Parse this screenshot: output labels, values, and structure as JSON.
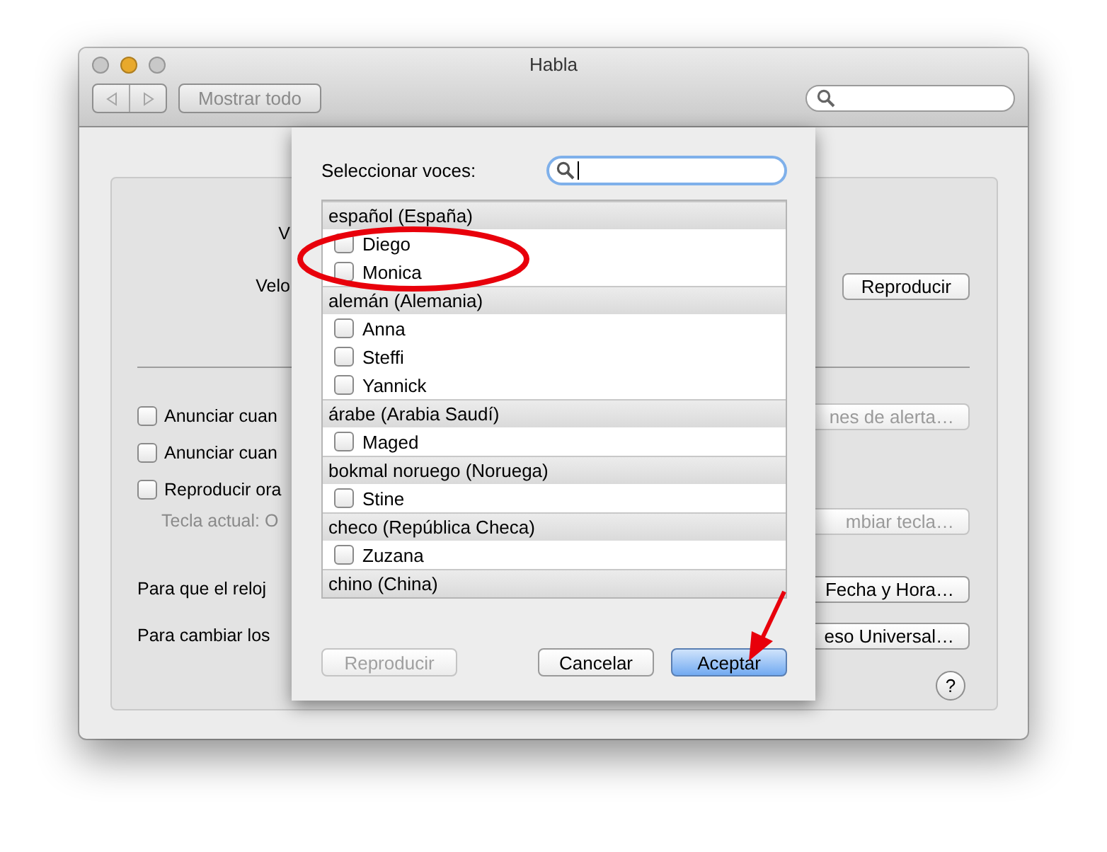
{
  "window": {
    "title": "Habla"
  },
  "traffic_lights": [
    {
      "kind": "close",
      "active": false
    },
    {
      "kind": "minimize",
      "active": true
    },
    {
      "kind": "zoom",
      "active": false
    }
  ],
  "nav_buttons": [
    {
      "kind": "back",
      "disabled": true
    },
    {
      "kind": "forward",
      "disabled": true
    }
  ],
  "show_all_button": {
    "label": "Mostrar todo"
  },
  "panel": {
    "sections": [
      {
        "rows": [
          {
            "left": {
              "kind": "text",
              "text": "V"
            }
          },
          {
            "left": {
              "kind": "text",
              "text": "Velo"
            },
            "right": {
              "label": "Reproducir",
              "disabled": false
            }
          }
        ]
      },
      {
        "rows": [
          {
            "left": {
              "kind": "checkbox",
              "text": "Anunciar cuan",
              "checked": false
            },
            "right": {
              "label": "nes de alerta…",
              "disabled": true
            }
          },
          {
            "left": {
              "kind": "checkbox",
              "text": "Anunciar cuan",
              "checked": false
            }
          },
          {
            "left": {
              "kind": "checkbox",
              "text": "Reproducir ora",
              "checked": false
            }
          },
          {
            "left": {
              "kind": "hint",
              "text": "Tecla actual: O"
            },
            "right": {
              "label": "mbiar tecla…",
              "disabled": true
            }
          },
          {
            "left": {
              "kind": "text",
              "text": "Para que el reloj"
            },
            "right": {
              "label": "Fecha y Hora…",
              "disabled": false
            }
          },
          {
            "left": {
              "kind": "text",
              "text": "Para cambiar los"
            },
            "right": {
              "label": "eso Universal…",
              "disabled": false
            }
          }
        ]
      }
    ],
    "help_button": {
      "label": "?"
    }
  },
  "voice_sheet": {
    "label": "Seleccionar voces:",
    "groups": [
      {
        "language": "español (España)",
        "voices": [
          {
            "name": "Diego",
            "checked": false
          },
          {
            "name": "Monica",
            "checked": false
          }
        ]
      },
      {
        "language": "alemán (Alemania)",
        "voices": [
          {
            "name": "Anna",
            "checked": false
          },
          {
            "name": "Steffi",
            "checked": false
          },
          {
            "name": "Yannick",
            "checked": false
          }
        ]
      },
      {
        "language": "árabe (Arabia Saudí)",
        "voices": [
          {
            "name": "Maged",
            "checked": false
          }
        ]
      },
      {
        "language": "bokmal noruego (Noruega)",
        "voices": [
          {
            "name": "Stine",
            "checked": false
          }
        ]
      },
      {
        "language": "checo (República Checa)",
        "voices": [
          {
            "name": "Zuzana",
            "checked": false
          }
        ]
      },
      {
        "language": "chino (China)"
      }
    ],
    "buttons": [
      {
        "label": "Reproducir",
        "kind": "plain",
        "disabled": true
      },
      {
        "label": "Cancelar",
        "kind": "plain",
        "disabled": false
      },
      {
        "label": "Aceptar",
        "kind": "default",
        "disabled": false
      }
    ]
  }
}
